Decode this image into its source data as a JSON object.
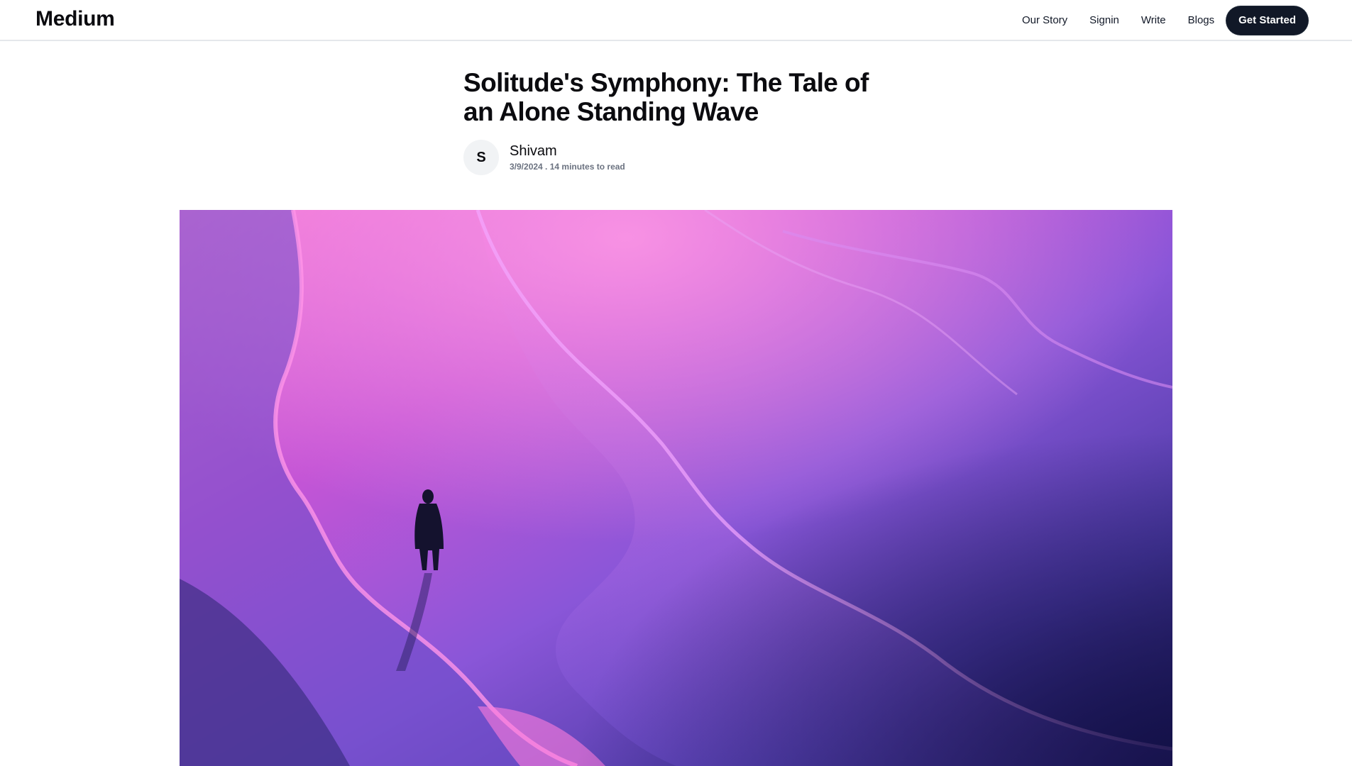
{
  "navbar": {
    "brand": "Medium",
    "links": [
      "Our Story",
      "Signin",
      "Write",
      "Blogs"
    ],
    "cta_label": "Get Started"
  },
  "article": {
    "title": "Solitude's Symphony: The Tale of an Alone Standing Wave",
    "author": {
      "initial": "S",
      "name": "Shivam",
      "meta": "3/9/2024 . 14 minutes to read"
    },
    "hero_image": {
      "palette": [
        "#f47ad8",
        "#c455d6",
        "#8a56d8",
        "#4b3aa5",
        "#1c1b5c"
      ]
    }
  }
}
